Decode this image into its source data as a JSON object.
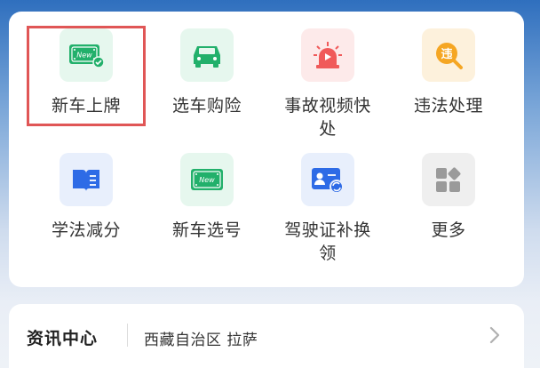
{
  "services": [
    {
      "label": "新车上牌",
      "icon": "new-plate-icon",
      "bg": "#e6f7ee",
      "color": "#22b06b"
    },
    {
      "label": "选车购险",
      "icon": "car-icon",
      "bg": "#e6f7ee",
      "color": "#22b06b"
    },
    {
      "label": "事故视频快处",
      "icon": "siren-video-icon",
      "bg": "#fdeaea",
      "color": "#f05a5a"
    },
    {
      "label": "违法处理",
      "icon": "violation-search-icon",
      "bg": "#fdf1dc",
      "color": "#f5a623",
      "glyph": "违"
    },
    {
      "label": "学法减分",
      "icon": "book-icon",
      "bg": "#e8effc",
      "color": "#2e6be6"
    },
    {
      "label": "新车选号",
      "icon": "new-plate-icon",
      "bg": "#e6f7ee",
      "color": "#22b06b"
    },
    {
      "label": "驾驶证补换领",
      "icon": "license-swap-icon",
      "bg": "#e8effc",
      "color": "#2e6be6"
    },
    {
      "label": "更多",
      "icon": "grid-more-icon",
      "bg": "#efefef",
      "color": "#9a9a9a"
    }
  ],
  "news": {
    "title": "资讯中心",
    "location": "西藏自治区 拉萨"
  },
  "new_badge_text": "New"
}
